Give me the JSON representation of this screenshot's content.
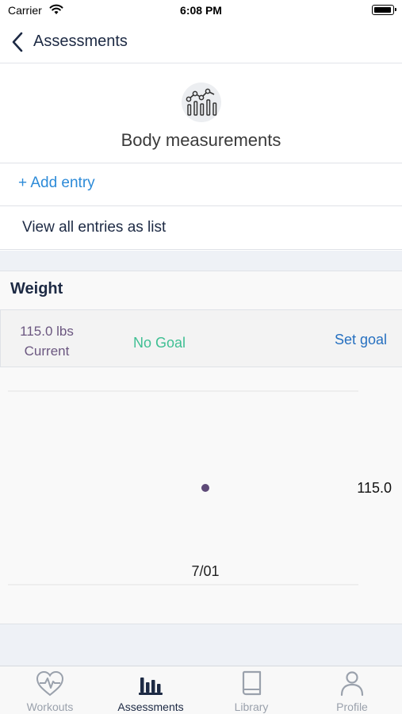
{
  "status_bar": {
    "carrier": "Carrier",
    "time": "6:08 PM"
  },
  "nav": {
    "back_label": "Assessments"
  },
  "header": {
    "title": "Body measurements",
    "icon": "chart-bars-icon"
  },
  "actions": {
    "add_entry": "+ Add entry",
    "view_all": "View all entries as list"
  },
  "weight": {
    "title": "Weight",
    "current_value": "115.0 lbs",
    "current_label": "Current",
    "goal_status": "No Goal",
    "set_goal": "Set goal"
  },
  "chart_data": {
    "type": "scatter",
    "x": [
      "7/01"
    ],
    "y": [
      115.0
    ],
    "x_tick_labels": [
      "7/01"
    ],
    "point_labels": [
      "115.0"
    ],
    "point_color": "#5e4a78"
  },
  "tabs": [
    {
      "label": "Workouts",
      "icon": "heart-pulse-icon",
      "active": false
    },
    {
      "label": "Assessments",
      "icon": "bar-chart-icon",
      "active": true
    },
    {
      "label": "Library",
      "icon": "book-icon",
      "active": false
    },
    {
      "label": "Profile",
      "icon": "person-icon",
      "active": false
    }
  ],
  "colors": {
    "accent_blue": "#2d8bd8",
    "goal_green": "#3fbf93",
    "navy": "#1d2a44",
    "inactive_gray": "#9aa1ac"
  }
}
